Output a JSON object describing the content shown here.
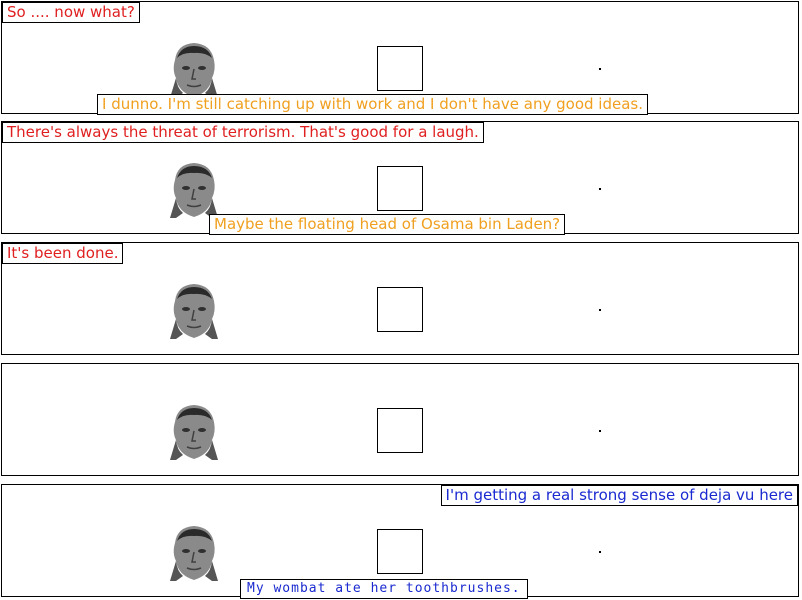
{
  "panels": [
    {
      "top_caption": "So .... now what?",
      "bottom_caption": "I dunno.  I'm still catching up with work and I don't have any good ideas."
    },
    {
      "top_caption": "There's always the threat of terrorism.  That's good for a laugh.",
      "bottom_caption": "Maybe the floating head of Osama bin Laden?"
    },
    {
      "top_caption": "It's been done."
    },
    {},
    {
      "top_caption": "I'm getting a real strong sense of deja vu here",
      "bottom_caption": "My wombat ate her toothbrushes."
    }
  ],
  "colors": {
    "red": "#e02020",
    "orange": "#f0a020",
    "blue": "#1a2ad0"
  },
  "icons": {
    "character": "mao-head-icon",
    "prop": "empty-square-icon"
  }
}
